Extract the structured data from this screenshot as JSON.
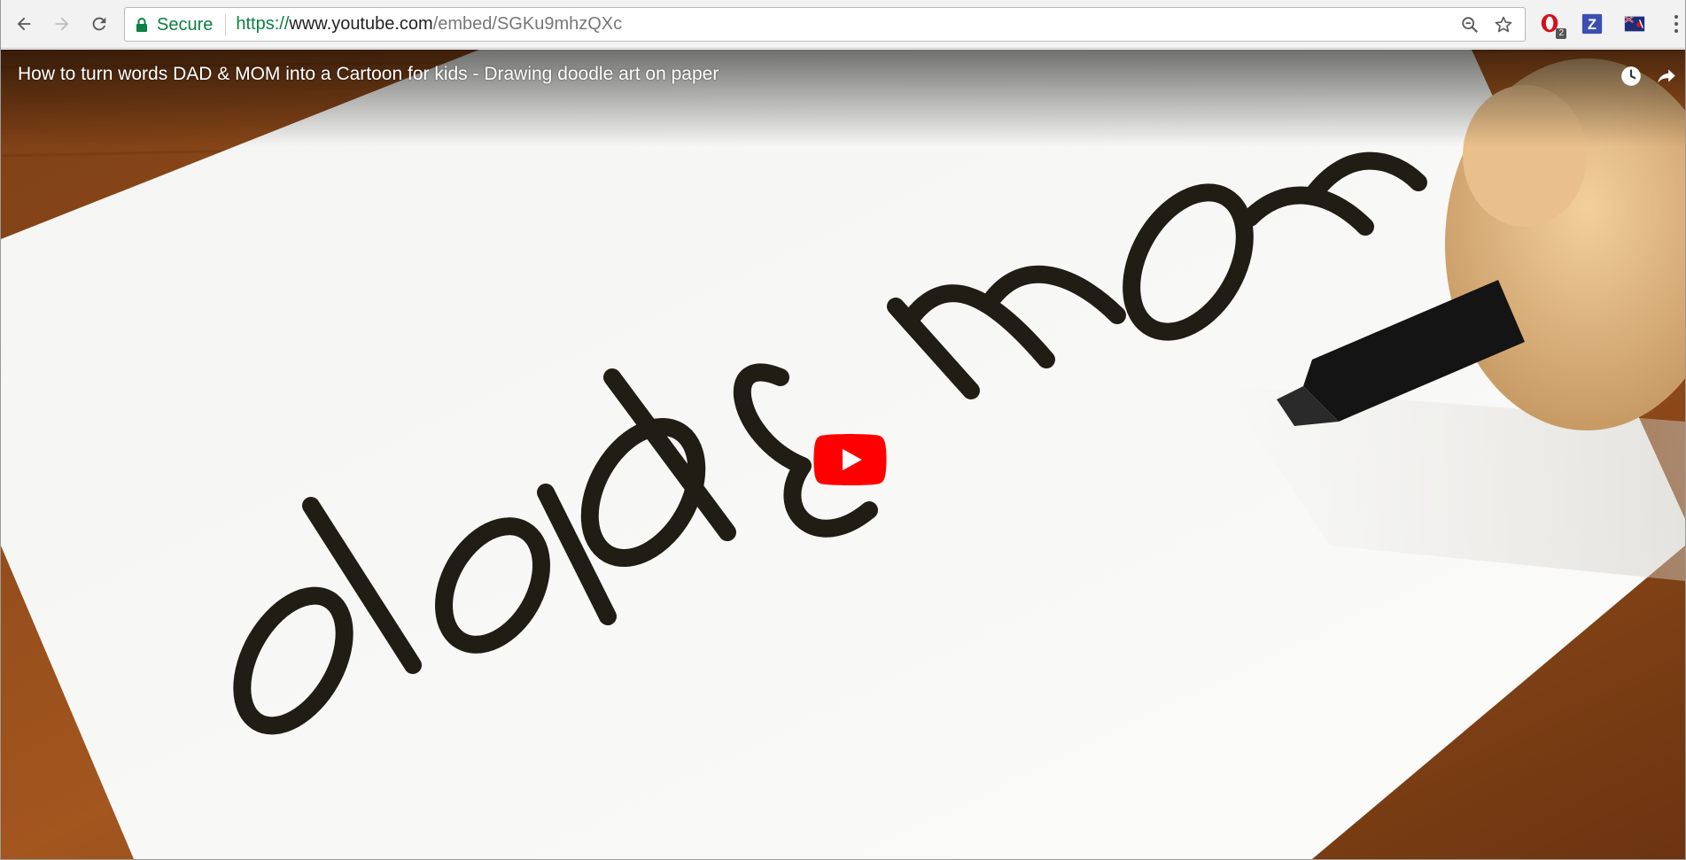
{
  "browser": {
    "security_label": "Secure",
    "url": {
      "scheme": "https://",
      "host": "www.youtube.com",
      "path": "/embed/SGKu9mhzQXc"
    },
    "extensions": [
      {
        "name": "opera-extension-icon",
        "badge": "2"
      },
      {
        "name": "z-extension-icon",
        "letter": "Z"
      },
      {
        "name": "flag-extension-icon"
      }
    ]
  },
  "video": {
    "title": "How to turn words DAD & MOM into a Cartoon for kids - Drawing doodle art on paper",
    "drawn_text_left": "dad",
    "drawn_text_amp": "&",
    "drawn_text_right": "mom",
    "accent_color": "#ff0000"
  }
}
